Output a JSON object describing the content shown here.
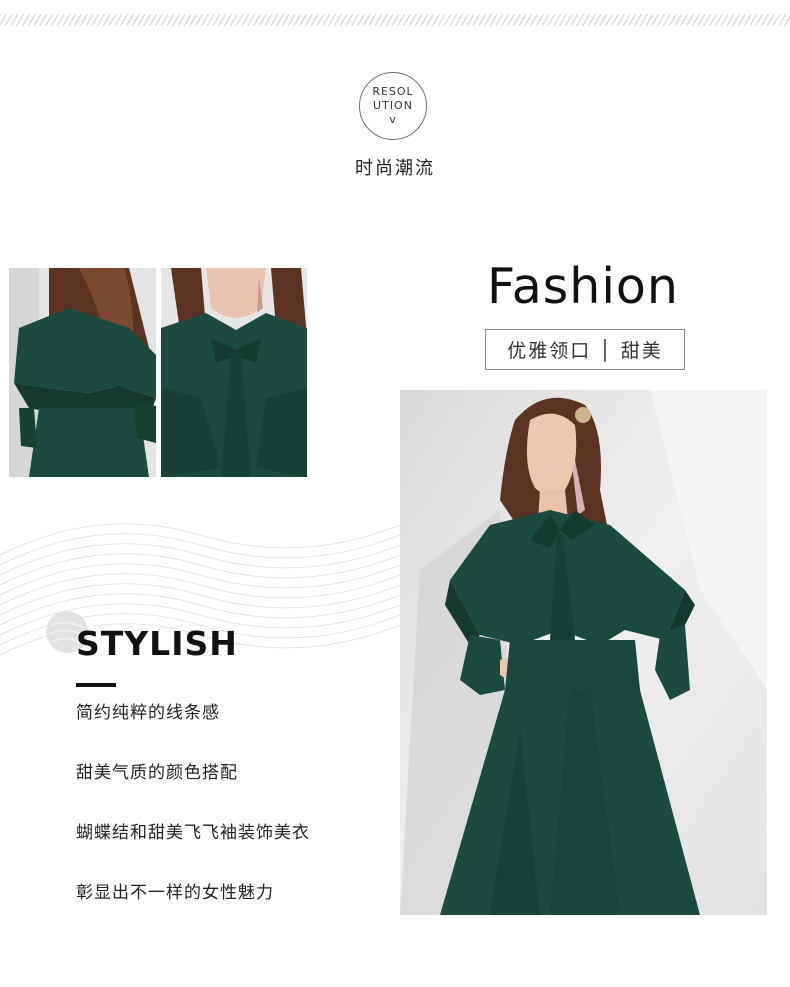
{
  "header": {
    "badge_lines": [
      "RESOL",
      "UTION",
      "v"
    ],
    "subtitle": "时尚潮流"
  },
  "fashion": {
    "title": "Fashion",
    "tag": "优雅领口 │ 甜美"
  },
  "stylish": {
    "title": "STYLISH",
    "features": [
      "简约纯粹的线条感",
      "甜美气质的颜色搭配",
      "蝴蝶结和甜美飞飞袖装饰美衣",
      "彰显出不一样的女性魅力"
    ]
  },
  "colors": {
    "dress_green": "#1c4a40",
    "hair_brown": "#5a3322",
    "photo_backdrop": "#e9e9e9"
  }
}
